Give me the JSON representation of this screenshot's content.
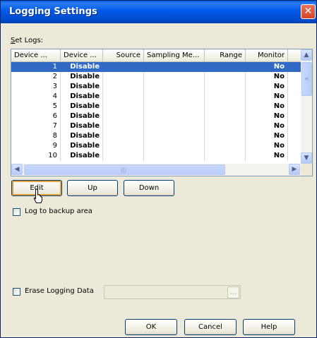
{
  "window": {
    "title": "Logging Settings",
    "close_glyph": "✕"
  },
  "set_logs": {
    "label": "Set Logs:"
  },
  "table": {
    "columns": [
      "Device ...",
      "Device ...",
      "Source",
      "Sampling Me...",
      "Range",
      "Monitor"
    ],
    "rows": [
      {
        "id": "1",
        "status": "Disable",
        "source": "",
        "sampling": "",
        "range": "",
        "monitor": "No",
        "selected": true
      },
      {
        "id": "2",
        "status": "Disable",
        "source": "",
        "sampling": "",
        "range": "",
        "monitor": "No"
      },
      {
        "id": "3",
        "status": "Disable",
        "source": "",
        "sampling": "",
        "range": "",
        "monitor": "No"
      },
      {
        "id": "4",
        "status": "Disable",
        "source": "",
        "sampling": "",
        "range": "",
        "monitor": "No"
      },
      {
        "id": "5",
        "status": "Disable",
        "source": "",
        "sampling": "",
        "range": "",
        "monitor": "No"
      },
      {
        "id": "6",
        "status": "Disable",
        "source": "",
        "sampling": "",
        "range": "",
        "monitor": "No"
      },
      {
        "id": "7",
        "status": "Disable",
        "source": "",
        "sampling": "",
        "range": "",
        "monitor": "No"
      },
      {
        "id": "8",
        "status": "Disable",
        "source": "",
        "sampling": "",
        "range": "",
        "monitor": "No"
      },
      {
        "id": "9",
        "status": "Disable",
        "source": "",
        "sampling": "",
        "range": "",
        "monitor": "No"
      },
      {
        "id": "10",
        "status": "Disable",
        "source": "",
        "sampling": "",
        "range": "",
        "monitor": "No"
      }
    ]
  },
  "buttons": {
    "edit": "Edit",
    "up": "Up",
    "down": "Down",
    "ok": "OK",
    "cancel": "Cancel",
    "help": "Help"
  },
  "log_backup": {
    "label": "Log to backup area",
    "checked": false
  },
  "erase": {
    "label": "Erase Logging Data",
    "checked": false,
    "value": "",
    "browse": "..."
  },
  "icons": {
    "scroll_up": "up-arrow-icon",
    "scroll_down": "down-arrow-icon",
    "scroll_left": "left-arrow-icon",
    "scroll_right": "right-arrow-icon",
    "cursor": "mouse-pointer-icon"
  }
}
